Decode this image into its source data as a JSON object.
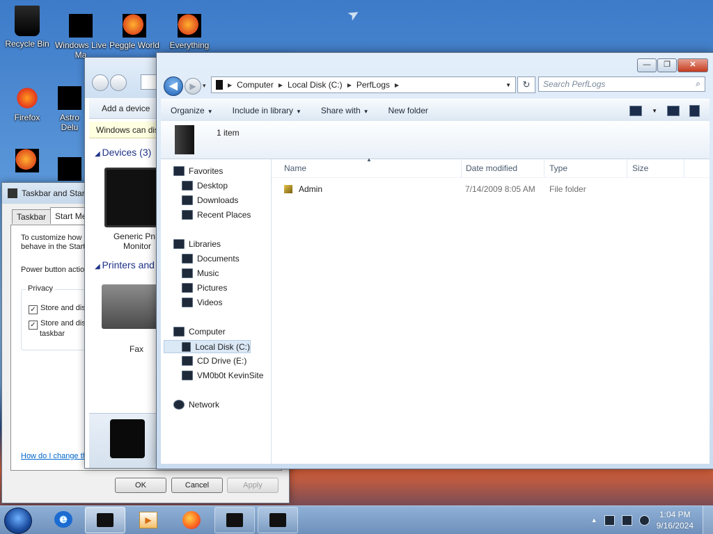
{
  "desktop": {
    "icons": [
      {
        "label": "Recycle Bin"
      },
      {
        "label": "Windows Live Ma"
      },
      {
        "label": "Peggle World"
      },
      {
        "label": "Everything"
      },
      {
        "label": "Firefox"
      },
      {
        "label": "Astro Delu"
      }
    ]
  },
  "taskbar_dialog": {
    "title": "Taskbar and Start",
    "tabs": [
      "Taskbar",
      "Start Menu"
    ],
    "intro_line1": "To customize how li",
    "intro_line2": "behave in the Start",
    "power_label": "Power button actio",
    "privacy_legend": "Privacy",
    "privacy_item1": "Store and disp",
    "privacy_item2_line1": "Store and disp",
    "privacy_item2_line2": "taskbar",
    "check_mark": "✓",
    "help_link": "How do I change th",
    "ok": "OK",
    "cancel": "Cancel",
    "apply": "Apply"
  },
  "devices_window": {
    "add_device": "Add a device",
    "info_bar": "Windows can dis",
    "devices_header": "Devices (3)",
    "monitor_label_1": "Generic PnP",
    "monitor_label_2": "Monitor",
    "printers_header": "Printers and",
    "fax_label": "Fax"
  },
  "explorer": {
    "caption": {
      "minimize": "—",
      "maximize": "❐",
      "close": "✕"
    },
    "back_glyph": "◀",
    "forward_glyph": "▶",
    "history_glyph": "▾",
    "breadcrumb": [
      "Computer",
      "Local Disk (C:)",
      "PerfLogs"
    ],
    "breadcrumb_sep": "▶",
    "address_drop": "▼",
    "refresh_glyph": "↻",
    "search_placeholder": "Search PerfLogs",
    "search_glyph": "⌕",
    "toolbar": {
      "organize": "Organize",
      "include": "Include in library",
      "share": "Share with",
      "new_folder": "New folder",
      "menu_arrow": "▼"
    },
    "details_count": "1 item",
    "nav": {
      "favorites": "Favorites",
      "desktop": "Desktop",
      "downloads": "Downloads",
      "recent": "Recent Places",
      "libraries": "Libraries",
      "documents": "Documents",
      "music": "Music",
      "pictures": "Pictures",
      "videos": "Videos",
      "computer": "Computer",
      "local_disk": "Local Disk (C:)",
      "cd_drive": "CD Drive (E:)",
      "vm": "VM0b0t KevinSite",
      "network": "Network"
    },
    "columns": {
      "name": "Name",
      "sort_glyph": "▲",
      "date": "Date modified",
      "type": "Type",
      "size": "Size"
    },
    "rows": [
      {
        "name": "Admin",
        "date": "7/14/2009 8:05 AM",
        "type": "File folder",
        "size": ""
      }
    ]
  },
  "taskbar": {
    "tray_arrow": "▲",
    "time": "1:04 PM",
    "date": "9/16/2024"
  }
}
